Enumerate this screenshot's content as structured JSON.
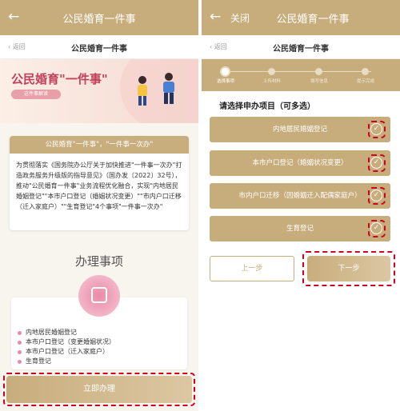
{
  "left": {
    "top_title": "公民婚育一件事",
    "back_icon": "←",
    "sub_back": "返回",
    "sub_title": "公民婚育一件事",
    "banner": {
      "headline": "公民婚育\"一件事\"",
      "pill": "这件事解读"
    },
    "intro": {
      "header": "公民婚育\"一件事\"，\"一件事一次办\"",
      "body": "为贯彻落实《国务院办公厅关于加快推进\"一件事一次办\"打造政务服务升级版的指导意见》（国办发〔2022〕32号），推动\"公民婚育一件事\"业务流程优化融合，实现\"内地居民婚姻登记\"\"本市户口登记（婚姻状况变更）\"\"市内户口迁移（迁入家庭户）\"\"生育登记\"4个事项\"一件事一次办\""
    },
    "section_title": "办理事项",
    "items": [
      "内地居民婚姻登记",
      "本市户口登记（变更婚姻状况）",
      "本市户口登记（迁入家庭户）",
      "生育登记"
    ],
    "apply_button": "立即办理"
  },
  "right": {
    "top_title": "公民婚育一件事",
    "back_icon": "←",
    "close_label": "关闭",
    "sub_back": "返回",
    "sub_title": "公民婚育一件事",
    "steps": [
      "选择事项",
      "上传材料",
      "填写信息",
      "提示完成"
    ],
    "current_step": 1,
    "choose_label": "请选择申办项目（可多选）",
    "options": [
      {
        "label": "内地居民婚姻登记",
        "checked": true
      },
      {
        "label": "本市户口登记（婚姻状况变更）",
        "checked": true
      },
      {
        "label": "市内户口迁移（因婚姻迁入配偶家庭户）",
        "checked": true
      },
      {
        "label": "生育登记",
        "checked": true
      }
    ],
    "check_glyph": "✓",
    "prev_button": "上一步",
    "next_button": "下一步"
  },
  "colors": {
    "gold": "#c8ad7c",
    "pink": "#e98aa8",
    "highlight": "#d0021b"
  }
}
